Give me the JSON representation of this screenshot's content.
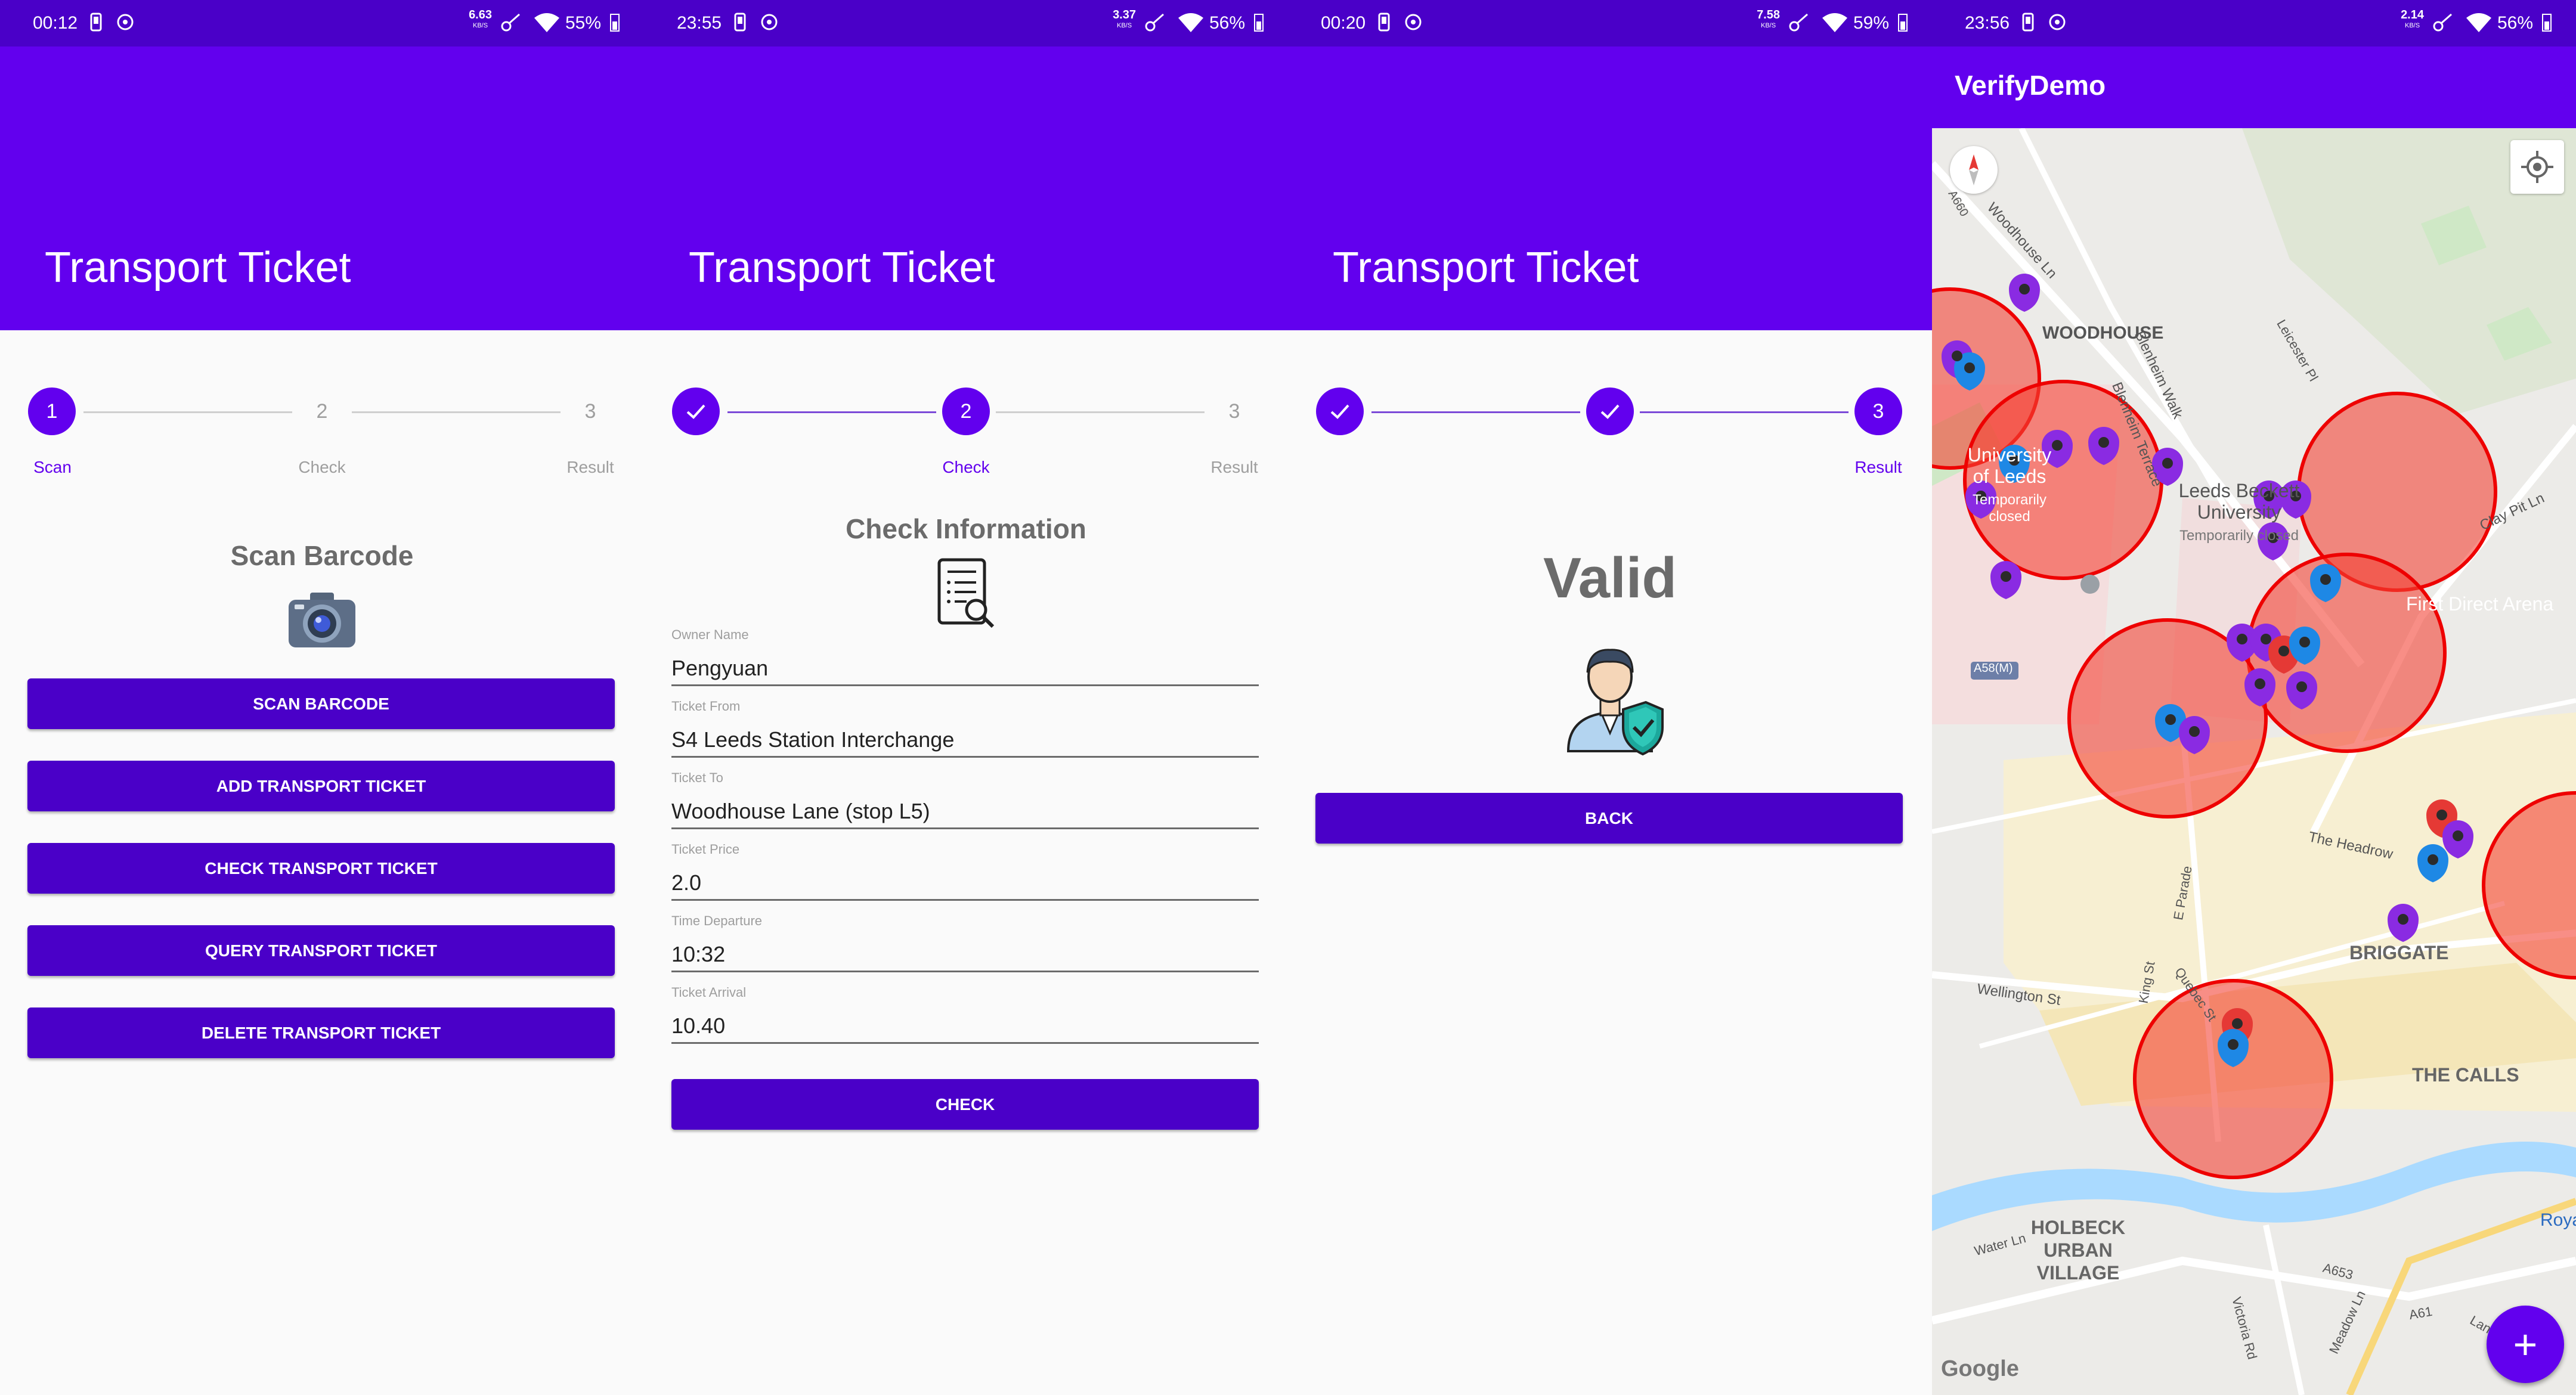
{
  "screens": [
    {
      "status": {
        "time": "00:12",
        "net": "6.63",
        "net_unit": "KB/S",
        "battery": "55%"
      },
      "title": "Transport Ticket",
      "steps": [
        {
          "label": "Scan",
          "num": "1",
          "state": "active"
        },
        {
          "label": "Check",
          "num": "2",
          "state": "pending"
        },
        {
          "label": "Result",
          "num": "3",
          "state": "pending"
        }
      ],
      "heading": "Scan Barcode",
      "buttons": [
        "SCAN BARCODE",
        "ADD TRANSPORT TICKET",
        "CHECK TRANSPORT TICKET",
        "QUERY TRANSPORT TICKET",
        "DELETE TRANSPORT TICKET"
      ]
    },
    {
      "status": {
        "time": "23:55",
        "net": "3.37",
        "net_unit": "KB/S",
        "battery": "56%"
      },
      "title": "Transport Ticket",
      "steps": [
        {
          "label": "",
          "num": "",
          "state": "done"
        },
        {
          "label": "Check",
          "num": "2",
          "state": "active"
        },
        {
          "label": "Result",
          "num": "3",
          "state": "pending"
        }
      ],
      "heading": "Check Information",
      "fields": [
        {
          "label": "Owner Name",
          "value": "Pengyuan"
        },
        {
          "label": "Ticket From",
          "value": "S4 Leeds Station Interchange"
        },
        {
          "label": "Ticket To",
          "value": "Woodhouse Lane (stop L5)"
        },
        {
          "label": "Ticket Price",
          "value": "2.0"
        },
        {
          "label": "Time Departure",
          "value": "10:32"
        },
        {
          "label": "Ticket Arrival",
          "value": "10.40"
        }
      ],
      "button": "CHECK"
    },
    {
      "status": {
        "time": "00:20",
        "net": "7.58",
        "net_unit": "KB/S",
        "battery": "59%"
      },
      "title": "Transport Ticket",
      "steps": [
        {
          "label": "",
          "num": "",
          "state": "done"
        },
        {
          "label": "",
          "num": "",
          "state": "done"
        },
        {
          "label": "Result",
          "num": "3",
          "state": "active"
        }
      ],
      "heading": "Valid",
      "button": "BACK"
    },
    {
      "status": {
        "time": "23:56",
        "net": "2.14",
        "net_unit": "KB/S",
        "battery": "56%"
      },
      "title": "VerifyDemo",
      "map_labels": {
        "woodhouse": "WOODHOUSE",
        "leeds_uni": "University of Leeds",
        "leeds_uni_status": "Temporarily closed",
        "beckett": "Leeds Beckett University",
        "beckett_status": "Temporarily closed",
        "first_direct": "First Direct Arena",
        "briggate": "BRIGGATE",
        "the_calls": "THE CALLS",
        "holbeck": "HOLBECK URBAN VILLAGE",
        "woodhouse_ln": "Woodhouse Ln",
        "blenheim_walk": "Blenheim Walk",
        "blenheim_terrace": "Blenheim Terrace",
        "leicester_pl": "Leicester Pl",
        "clay_pit_ln": "Clay Pit Ln",
        "the_headrow": "The Headrow",
        "wellington_st": "Wellington St",
        "king_st": "King St",
        "quebec_st": "Quebec St",
        "e_parade": "E Parade",
        "water_ln": "Water Ln",
        "victoria_rd": "Victoria Rd",
        "meadow_ln": "Meadow Ln",
        "a653": "A653",
        "a61": "A61",
        "a58m": "A58(M)",
        "a660": "A660",
        "royal": "Roya",
        "google": "Google",
        "lands": "Lands"
      },
      "fab_label": "+",
      "colors": {
        "pin_purple": "#8a2be2",
        "pin_blue": "#1e88e5",
        "pin_red": "#e53935",
        "zone_fill": "#f44336"
      }
    }
  ],
  "colors": {
    "primary": "#6200ee",
    "primary_dark": "#4a00c8"
  }
}
